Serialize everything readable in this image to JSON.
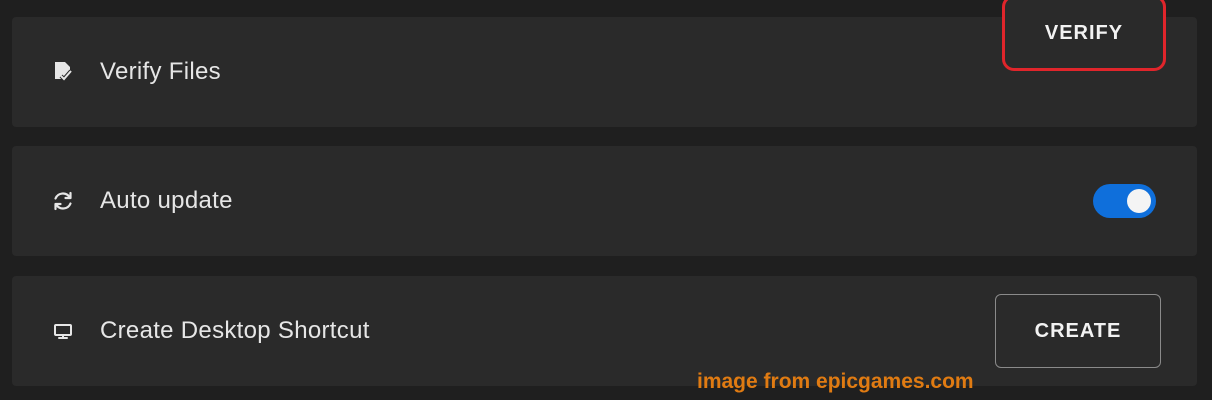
{
  "settings": {
    "verify": {
      "label": "Verify Files",
      "button_label": "VERIFY",
      "icon": "file-check-icon"
    },
    "auto_update": {
      "label": "Auto update",
      "enabled": true,
      "icon": "refresh-icon"
    },
    "shortcut": {
      "label": "Create Desktop Shortcut",
      "button_label": "CREATE",
      "icon": "monitor-icon"
    }
  },
  "highlight_color": "#e0252b",
  "toggle_color": "#0f6fdb",
  "watermark": {
    "text": "image from epicgames.com",
    "color": "#e07b12"
  }
}
